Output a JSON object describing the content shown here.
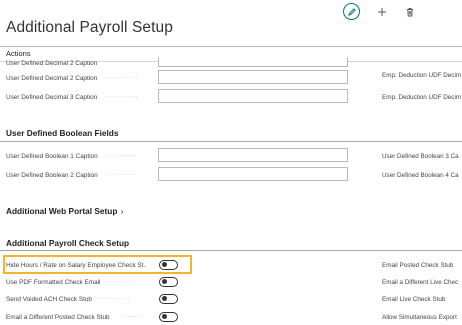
{
  "page": {
    "title": "Additional Payroll Setup"
  },
  "toolbar": {
    "edit_icon": "pencil-icon",
    "add_icon": "plus-icon",
    "delete_icon": "trash-icon"
  },
  "actions": {
    "label": "Actions"
  },
  "decimal_rows": [
    {
      "label": "User Defined Decimal 2 Caption",
      "right_label": "Emp. Deduction UDF Decim"
    },
    {
      "label": "User Defined Decimal 3 Caption",
      "right_label": "Emp. Deduction UDF Decim"
    }
  ],
  "boolean_section": {
    "title": "User Defined Boolean Fields",
    "rows": [
      {
        "label": "User Defined Boolean 1 Caption",
        "right_label": "User Defined Boolean 3 Ca"
      },
      {
        "label": "User Defined Boolean 2 Caption",
        "right_label": "User Defined Boolean 4 Ca"
      }
    ]
  },
  "web_portal_section": {
    "title": "Additional Web Portal Setup",
    "chevron": "›"
  },
  "check_section": {
    "title": "Additional Payroll Check Setup",
    "rows": [
      {
        "label": "Hide Hours / Rate on Salary Employee Check St...",
        "toggle_on": false,
        "right_label": "Email Posted Check Stub"
      },
      {
        "label": "Use PDF Formatted Check Email",
        "toggle_on": false,
        "right_label": "Email a Different Live Chec"
      },
      {
        "label": "Send Voided ACH Check Stub",
        "toggle_on": false,
        "right_label": "Email Live Check Stub"
      },
      {
        "label": "Email a Different Posted Check Stub",
        "toggle_on": false,
        "right_label": "Allow Simultaneous Export"
      }
    ]
  },
  "colors": {
    "accent": "#00796b",
    "highlight": "#f0b52c"
  }
}
